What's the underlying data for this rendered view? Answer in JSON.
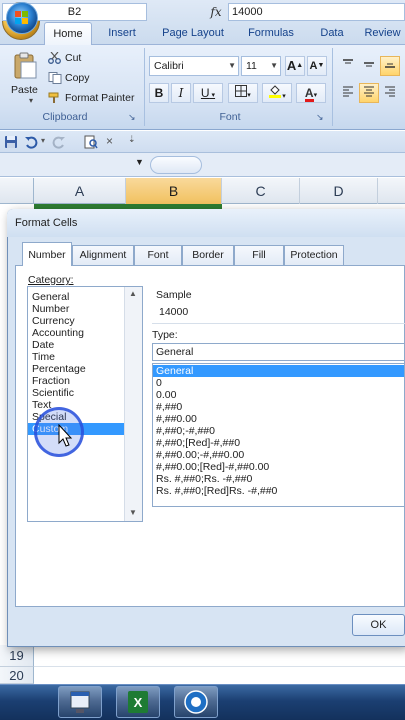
{
  "ribbon": {
    "tabs": [
      {
        "label": "Home",
        "active": true
      },
      {
        "label": "Insert",
        "active": false
      },
      {
        "label": "Page Layout",
        "active": false
      },
      {
        "label": "Formulas",
        "active": false
      },
      {
        "label": "Data",
        "active": false
      },
      {
        "label": "Review",
        "active": false
      }
    ],
    "clipboard": {
      "paste_label": "Paste",
      "cut_label": "Cut",
      "copy_label": "Copy",
      "format_painter_label": "Format Painter",
      "group_label": "Clipboard"
    },
    "font": {
      "font_name": "Calibri",
      "font_size": "11",
      "bold": "B",
      "italic": "I",
      "underline": "U",
      "grow": "A",
      "shrink": "A",
      "font_color_glyph": "A",
      "group_label": "Font"
    }
  },
  "formula_bar": {
    "name_box": "B2",
    "fx": "fx",
    "value": "14000"
  },
  "sheet": {
    "columns": [
      "A",
      "B",
      "C",
      "D"
    ],
    "selected_column": "B",
    "rows_visible_bottom": [
      "19",
      "20"
    ]
  },
  "dialog": {
    "title": "Format Cells",
    "tabs": [
      {
        "label": "Number",
        "active": true
      },
      {
        "label": "Alignment",
        "active": false
      },
      {
        "label": "Font",
        "active": false
      },
      {
        "label": "Border",
        "active": false
      },
      {
        "label": "Fill",
        "active": false
      },
      {
        "label": "Protection",
        "active": false
      }
    ],
    "category_label": "Category:",
    "categories": [
      "General",
      "Number",
      "Currency",
      "Accounting",
      "Date",
      "Time",
      "Percentage",
      "Fraction",
      "Scientific",
      "Text",
      "Special",
      "Custom"
    ],
    "selected_category": "Custom",
    "sample_label": "Sample",
    "sample_value": "14000",
    "type_label": "Type:",
    "type_value": "General",
    "type_list": [
      "General",
      "0",
      "0.00",
      "#,##0",
      "#,##0.00",
      "#,##0;-#,##0",
      "#,##0;[Red]-#,##0",
      "#,##0.00;-#,##0.00",
      "#,##0.00;[Red]-#,##0.00",
      "Rs. #,##0;Rs. -#,##0",
      "Rs. #,##0;[Red]Rs. -#,##0"
    ],
    "selected_type": "General",
    "ok_label": "OK"
  },
  "colors": {
    "selection_blue": "#3399ff",
    "ribbon_bg": "#d5e2f3",
    "highlight_orange": "#f1c15f",
    "taskbar": "#1b3f72"
  },
  "icons": [
    "office-button-icon",
    "paste-icon",
    "cut-icon",
    "copy-icon",
    "format-painter-icon",
    "save-icon",
    "undo-icon",
    "redo-icon",
    "print-preview-icon",
    "start-icon",
    "word-taskbar-icon",
    "excel-taskbar-icon",
    "app-taskbar-icon",
    "mouse-pointer-icon"
  ]
}
